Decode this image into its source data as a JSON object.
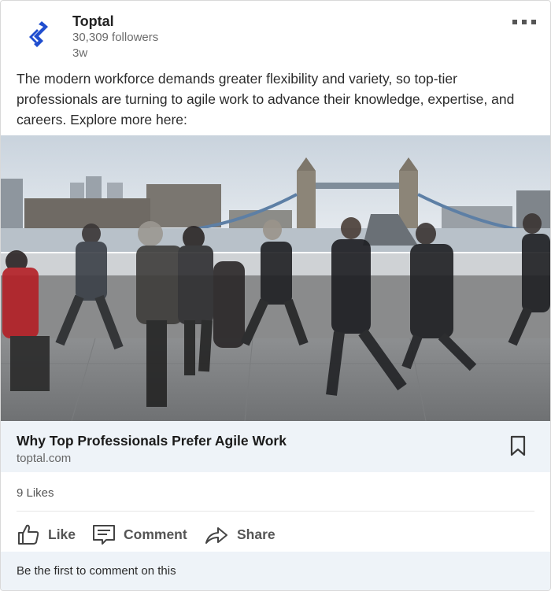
{
  "post": {
    "author": "Toptal",
    "followers": "30,309 followers",
    "time": "3w",
    "more_icon": "ellipsis-icon",
    "text": "The modern workforce demands greater flexibility and variety, so top-tier professionals are turning to agile work to advance their knowledge, expertise, and careers. Explore more here:"
  },
  "image": {
    "subject": "commuters-walking-by-tower-bridge-photo"
  },
  "link": {
    "title": "Why Top Professionals Prefer Agile Work",
    "domain": "toptal.com",
    "icon": "bookmark-icon"
  },
  "social": {
    "likes": "9 Likes"
  },
  "actions": [
    {
      "label": "Like",
      "icon": "thumbs-up-icon"
    },
    {
      "label": "Comment",
      "icon": "comment-icon"
    },
    {
      "label": "Share",
      "icon": "share-icon"
    }
  ],
  "comment_prompt": "Be the first to comment on this",
  "colors": {
    "brand": "#204ecf",
    "link_bg": "#eef3f8"
  }
}
